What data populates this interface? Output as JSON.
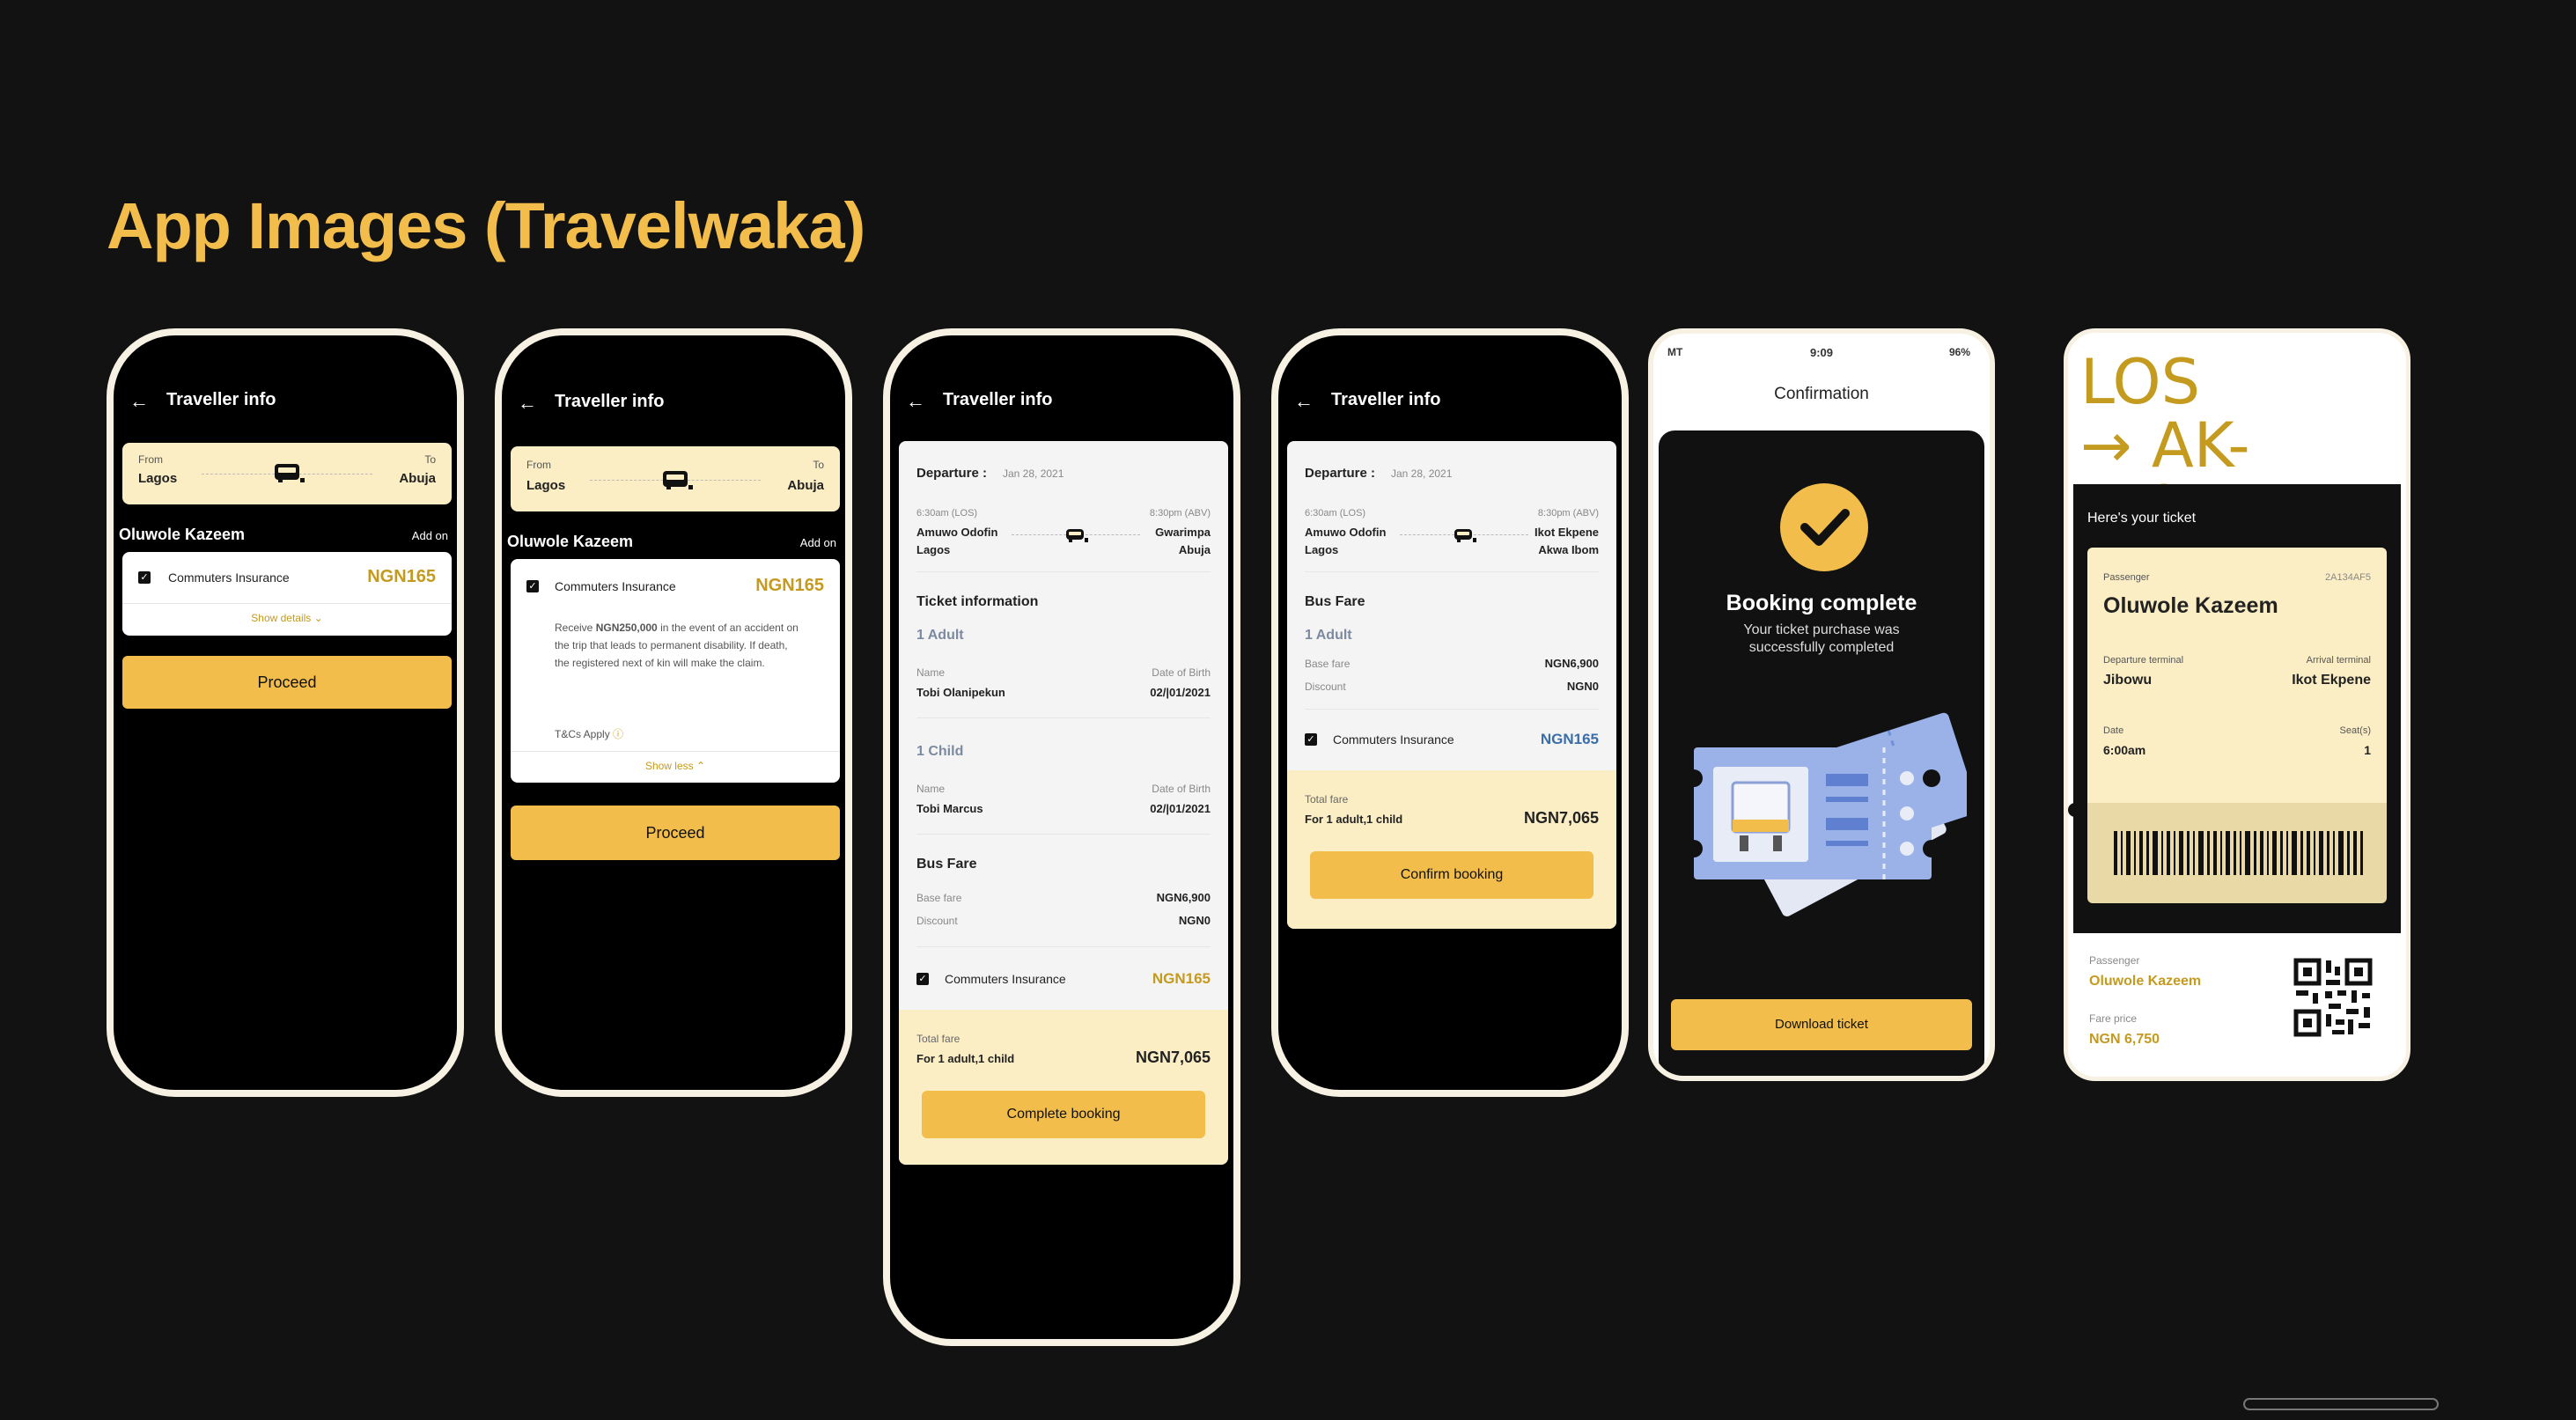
{
  "page_title": "App Images (Travelwaka)",
  "colors": {
    "accent": "#f2bd4a",
    "gold_text": "#c49a1f",
    "pale_yellow": "#fbeec5",
    "blue_text": "#3b6ea8",
    "background": "#121212"
  },
  "phone1": {
    "header": "Traveller info",
    "from_label": "From",
    "from_city": "Lagos",
    "to_label": "To",
    "to_city": "Abuja",
    "passenger": "Oluwole Kazeem",
    "addon": "Add on",
    "insurance_label": "Commuters Insurance",
    "insurance_price": "NGN165",
    "show_details": "Show details",
    "proceed": "Proceed"
  },
  "phone2": {
    "header": "Traveller info",
    "from_label": "From",
    "from_city": "Lagos",
    "to_label": "To",
    "to_city": "Abuja",
    "passenger": "Oluwole Kazeem",
    "addon": "Add on",
    "insurance_label": "Commuters Insurance",
    "insurance_price": "NGN165",
    "desc_pre": "Receive ",
    "desc_amount": "NGN250,000",
    "desc_post": " in the event of an accident on the trip that leads to permanent disability. If death, the registered next of kin will make the claim.",
    "tcs": "T&Cs Apply",
    "show_less": "Show less",
    "proceed": "Proceed"
  },
  "phone3": {
    "header": "Traveller info",
    "departure_label": "Departure :",
    "departure_date": "Jan 28, 2021",
    "dep_time": "6:30am (LOS)",
    "dep_place1": "Amuwo Odofin",
    "dep_place2": "Lagos",
    "arr_time": "8:30pm (ABV)",
    "arr_place1": "Gwarimpa",
    "arr_place2": "Abuja",
    "ticket_info": "Ticket information",
    "adult_heading": "1 Adult",
    "name_label": "Name",
    "dob_label": "Date of Birth",
    "adult_name": "Tobi Olanipekun",
    "adult_dob": "02/|01/2021",
    "child_heading": "1 Child",
    "child_name": "Tobi Marcus",
    "child_dob": "02/|01/2021",
    "bus_fare": "Bus Fare",
    "base_fare_label": "Base fare",
    "base_fare": "NGN6,900",
    "discount_label": "Discount",
    "discount": "NGN0",
    "insurance_label": "Commuters Insurance",
    "insurance_price": "NGN165",
    "total_label": "Total fare",
    "total_desc": "For 1 adult,1 child",
    "total": "NGN7,065",
    "button": "Complete booking"
  },
  "phone4": {
    "header": "Traveller info",
    "departure_label": "Departure :",
    "departure_date": "Jan 28, 2021",
    "dep_time": "6:30am (LOS)",
    "dep_place1": "Amuwo Odofin",
    "dep_place2": "Lagos",
    "arr_time": "8:30pm (ABV)",
    "arr_place1": "Ikot Ekpene",
    "arr_place2": "Akwa Ibom",
    "bus_fare": "Bus Fare",
    "adult_heading": "1 Adult",
    "base_fare_label": "Base fare",
    "base_fare": "NGN6,900",
    "discount_label": "Discount",
    "discount": "NGN0",
    "insurance_label": "Commuters Insurance",
    "insurance_price": "NGN165",
    "total_label": "Total fare",
    "total_desc": "For 1 adult,1 child",
    "total": "NGN7,065",
    "button": "Confirm booking"
  },
  "phone5": {
    "status_carrier": "MT",
    "status_time": "9:09",
    "status_battery": "96%",
    "header": "Confirmation",
    "booking_title": "Booking complete",
    "booking_sub1": "Your ticket purchase was",
    "booking_sub2": "successfully completed",
    "button": "Download ticket"
  },
  "phone6": {
    "route_from": "LOS",
    "route_arrow": "→",
    "route_to": "AK-IBOM",
    "heres_ticket": "Here's your ticket",
    "passenger_label": "Passenger",
    "ticket_code": "2A134AF5",
    "passenger_name": "Oluwole Kazeem",
    "dep_terminal_label": "Departure terminal",
    "dep_terminal": "Jibowu",
    "arr_terminal_label": "Arrival terminal",
    "arr_terminal": "Ikot Ekpene",
    "date_label": "Date",
    "date_value": "6:00am",
    "seat_label": "Seat(s)",
    "seat_value": "1",
    "footer_passenger_label": "Passenger",
    "footer_passenger": "Oluwole Kazeem",
    "fare_label": "Fare price",
    "fare_value": "NGN 6,750"
  }
}
